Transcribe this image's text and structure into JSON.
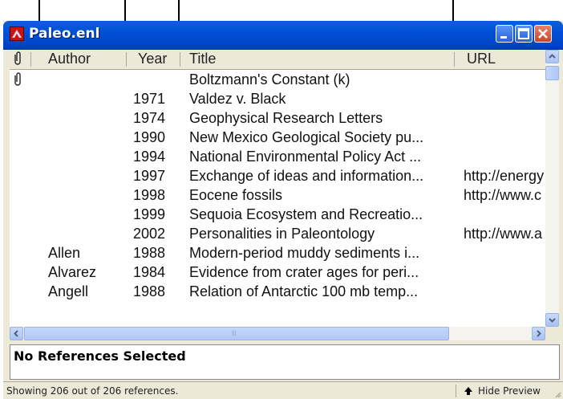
{
  "window": {
    "title": "Paleo.enl",
    "minimize_icon": "minimize-icon",
    "maximize_icon": "maximize-icon",
    "close_icon": "close-icon"
  },
  "columns": {
    "attachment_icon": "paperclip-icon",
    "author": "Author",
    "year": "Year",
    "title": "Title",
    "url": "URL"
  },
  "rows": [
    {
      "clip": "📎",
      "author": "",
      "year": "",
      "title": "Boltzmann's Constant (k)",
      "url": ""
    },
    {
      "clip": "",
      "author": "",
      "year": "1971",
      "title": "Valdez v. Black",
      "url": ""
    },
    {
      "clip": "",
      "author": "",
      "year": "1974",
      "title": "Geophysical Research Letters",
      "url": ""
    },
    {
      "clip": "",
      "author": "",
      "year": "1990",
      "title": "New Mexico Geological Society pu...",
      "url": ""
    },
    {
      "clip": "",
      "author": "",
      "year": "1994",
      "title": "National Environmental Policy Act ...",
      "url": ""
    },
    {
      "clip": "",
      "author": "",
      "year": "1997",
      "title": "Exchange of ideas and information...",
      "url": "http://energy"
    },
    {
      "clip": "",
      "author": "",
      "year": "1998",
      "title": "Eocene fossils",
      "url": "http://www.c"
    },
    {
      "clip": "",
      "author": "",
      "year": "1999",
      "title": "Sequoia Ecosystem and Recreatio...",
      "url": ""
    },
    {
      "clip": "",
      "author": "",
      "year": "2002",
      "title": "Personalities in Paleontology",
      "url": "http://www.a"
    },
    {
      "clip": "",
      "author": "Allen",
      "year": "1988",
      "title": "Modern-period muddy sediments i...",
      "url": ""
    },
    {
      "clip": "",
      "author": "Alvarez",
      "year": "1984",
      "title": "Evidence from crater ages for peri...",
      "url": ""
    },
    {
      "clip": "",
      "author": "Angell",
      "year": "1988",
      "title": "Relation of Antarctic 100 mb temp...",
      "url": ""
    }
  ],
  "preview": {
    "text": "No References Selected"
  },
  "status": {
    "text": "Showing 206 out of 206 references.",
    "hide_preview_label": "Hide Preview",
    "hide_preview_icon": "up-arrow-icon"
  },
  "colors": {
    "titlebar": "#0054e3",
    "chrome": "#ece9d8",
    "close_button": "#d8593c"
  }
}
